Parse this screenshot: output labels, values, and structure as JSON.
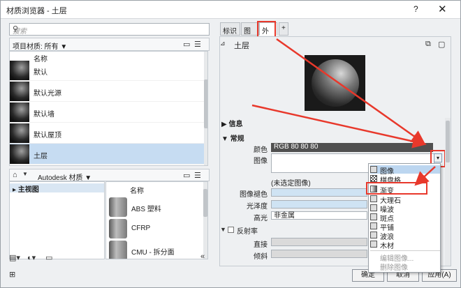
{
  "window": {
    "title": "材质浏览器 - 土层",
    "help": "?",
    "close": "✕"
  },
  "left": {
    "search_placeholder": "搜索",
    "filter_label": "项目材质: 所有 ▼",
    "column_name": "名称",
    "materials": [
      "默认",
      "默认光源",
      "默认墙",
      "默认屋顶",
      "土层"
    ],
    "nav_label": "Autodesk 材质 ▼",
    "tree_item": "▸ 主视图",
    "library_column": "名称",
    "library_items": [
      "ABS 塑料",
      "CFRP",
      "CMU - 拆分面"
    ]
  },
  "right": {
    "tabs": [
      "标识",
      "图形",
      "外观",
      "+"
    ],
    "asset_name": "土层",
    "sections": {
      "info": "▶ 信息",
      "general": "▼ 常规",
      "reflect": "反射率"
    },
    "props": {
      "color_label": "颜色",
      "color_value": "RGB 80 80 80",
      "image_label": "图像",
      "no_image": "(未选定图像)",
      "fade_label": "图像褪色",
      "gloss_label": "光泽度",
      "highlight_label": "高光",
      "highlight_value": "非金属",
      "direct_label": "直接",
      "oblique_label": "倾斜"
    },
    "dropdown_arrow": "▾"
  },
  "popup": {
    "items": [
      "图像",
      "棋盘格",
      "渐变",
      "大理石",
      "噪波",
      "斑点",
      "平铺",
      "波浪",
      "木材"
    ],
    "disabled": [
      "编辑图像...",
      "删除图像"
    ]
  },
  "buttons": {
    "ok": "确定",
    "cancel": "取消",
    "apply": "应用(A)"
  },
  "colors": {
    "accent_red": "#e8382b",
    "selection": "#c6dcf2"
  }
}
